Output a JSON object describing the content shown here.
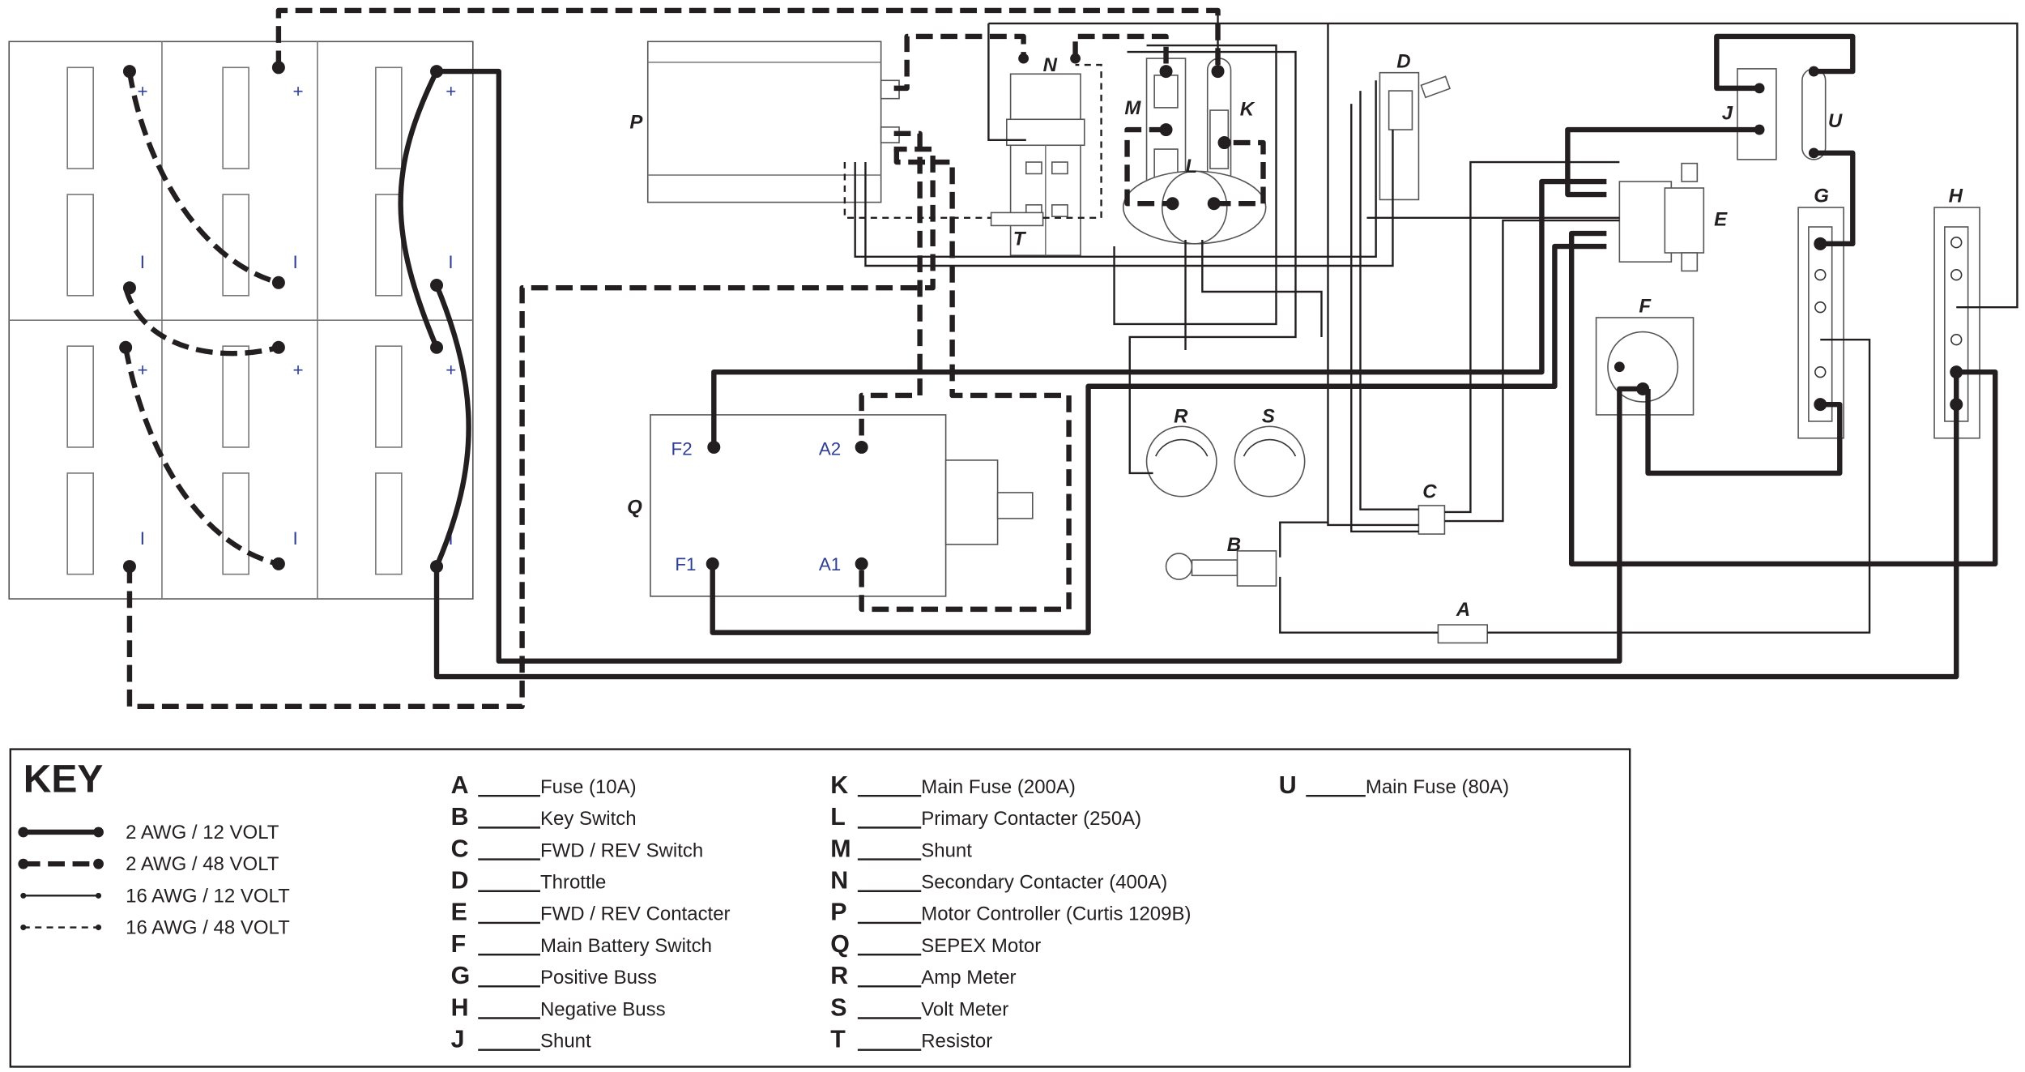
{
  "diagram": {
    "component_labels": {
      "A": "A",
      "B": "B",
      "C": "C",
      "D": "D",
      "E": "E",
      "F": "F",
      "G": "G",
      "H": "H",
      "J": "J",
      "K": "K",
      "L": "L",
      "M": "M",
      "N": "N",
      "P": "P",
      "Q": "Q",
      "R": "R",
      "S": "S",
      "T": "T",
      "U": "U"
    },
    "motor_terminals": {
      "f2": "F2",
      "a2": "A2",
      "f1": "F1",
      "a1": "A1"
    },
    "battery_polarity": {
      "plus": "+",
      "minus": "I"
    }
  },
  "key": {
    "title": "KEY",
    "wire_legend": [
      {
        "label": "2 AWG / 12 VOLT",
        "style": "thick-solid"
      },
      {
        "label": "2 AWG / 48 VOLT",
        "style": "thick-dashed"
      },
      {
        "label": "16 AWG / 12 VOLT",
        "style": "thin-solid"
      },
      {
        "label": "16 AWG / 48 VOLT",
        "style": "thin-dashed"
      }
    ],
    "components": [
      {
        "letter": "A",
        "name": "Fuse (10A)"
      },
      {
        "letter": "B",
        "name": "Key Switch"
      },
      {
        "letter": "C",
        "name": "FWD / REV Switch"
      },
      {
        "letter": "D",
        "name": "Throttle"
      },
      {
        "letter": "E",
        "name": "FWD / REV Contacter"
      },
      {
        "letter": "F",
        "name": "Main Battery Switch"
      },
      {
        "letter": "G",
        "name": "Positive Buss"
      },
      {
        "letter": "H",
        "name": "Negative Buss"
      },
      {
        "letter": "J",
        "name": "Shunt"
      },
      {
        "letter": "K",
        "name": "Main Fuse (200A)"
      },
      {
        "letter": "L",
        "name": "Primary Contacter (250A)"
      },
      {
        "letter": "M",
        "name": "Shunt"
      },
      {
        "letter": "N",
        "name": "Secondary Contacter (400A)"
      },
      {
        "letter": "P",
        "name": "Motor Controller (Curtis 1209B)"
      },
      {
        "letter": "Q",
        "name": "SEPEX Motor"
      },
      {
        "letter": "R",
        "name": "Amp Meter"
      },
      {
        "letter": "S",
        "name": "Volt Meter"
      },
      {
        "letter": "T",
        "name": "Resistor"
      },
      {
        "letter": "U",
        "name": "Main Fuse (80A)"
      }
    ]
  },
  "colors": {
    "ink": "#231f20",
    "terminal_text": "#2e3f95"
  }
}
